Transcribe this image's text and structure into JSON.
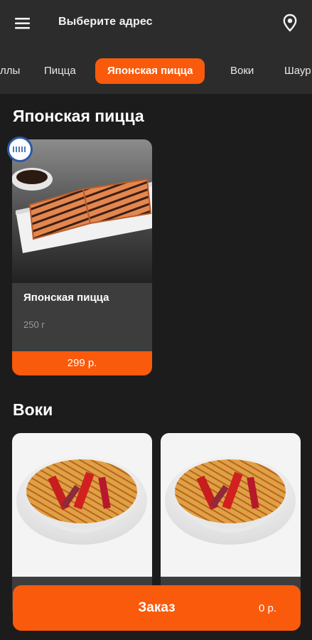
{
  "header": {
    "address_label": "Выберите адрес",
    "menu_icon": "hamburger-menu-icon",
    "location_icon": "location-pin-icon"
  },
  "tabs": [
    {
      "label": "ллы",
      "active": false
    },
    {
      "label": "Пицца",
      "active": false
    },
    {
      "label": "Японская пицца",
      "active": true
    },
    {
      "label": "Воки",
      "active": false
    },
    {
      "label": "Шаур",
      "active": false
    }
  ],
  "sections": [
    {
      "title": "Японская пицца",
      "items": [
        {
          "name": "Японская пицца",
          "weight": "250 г",
          "price": "299 р."
        }
      ]
    },
    {
      "title": "Воки",
      "items": [
        {
          "name": "",
          "weight": "",
          "price": ""
        },
        {
          "name": "",
          "weight": "",
          "price": ""
        }
      ]
    }
  ],
  "order": {
    "label": "Заказ",
    "sum": "0 р."
  },
  "colors": {
    "accent": "#f95a0c",
    "background": "#1c1c1c",
    "header": "#2c2c2c",
    "card": "#3d3d3d"
  }
}
